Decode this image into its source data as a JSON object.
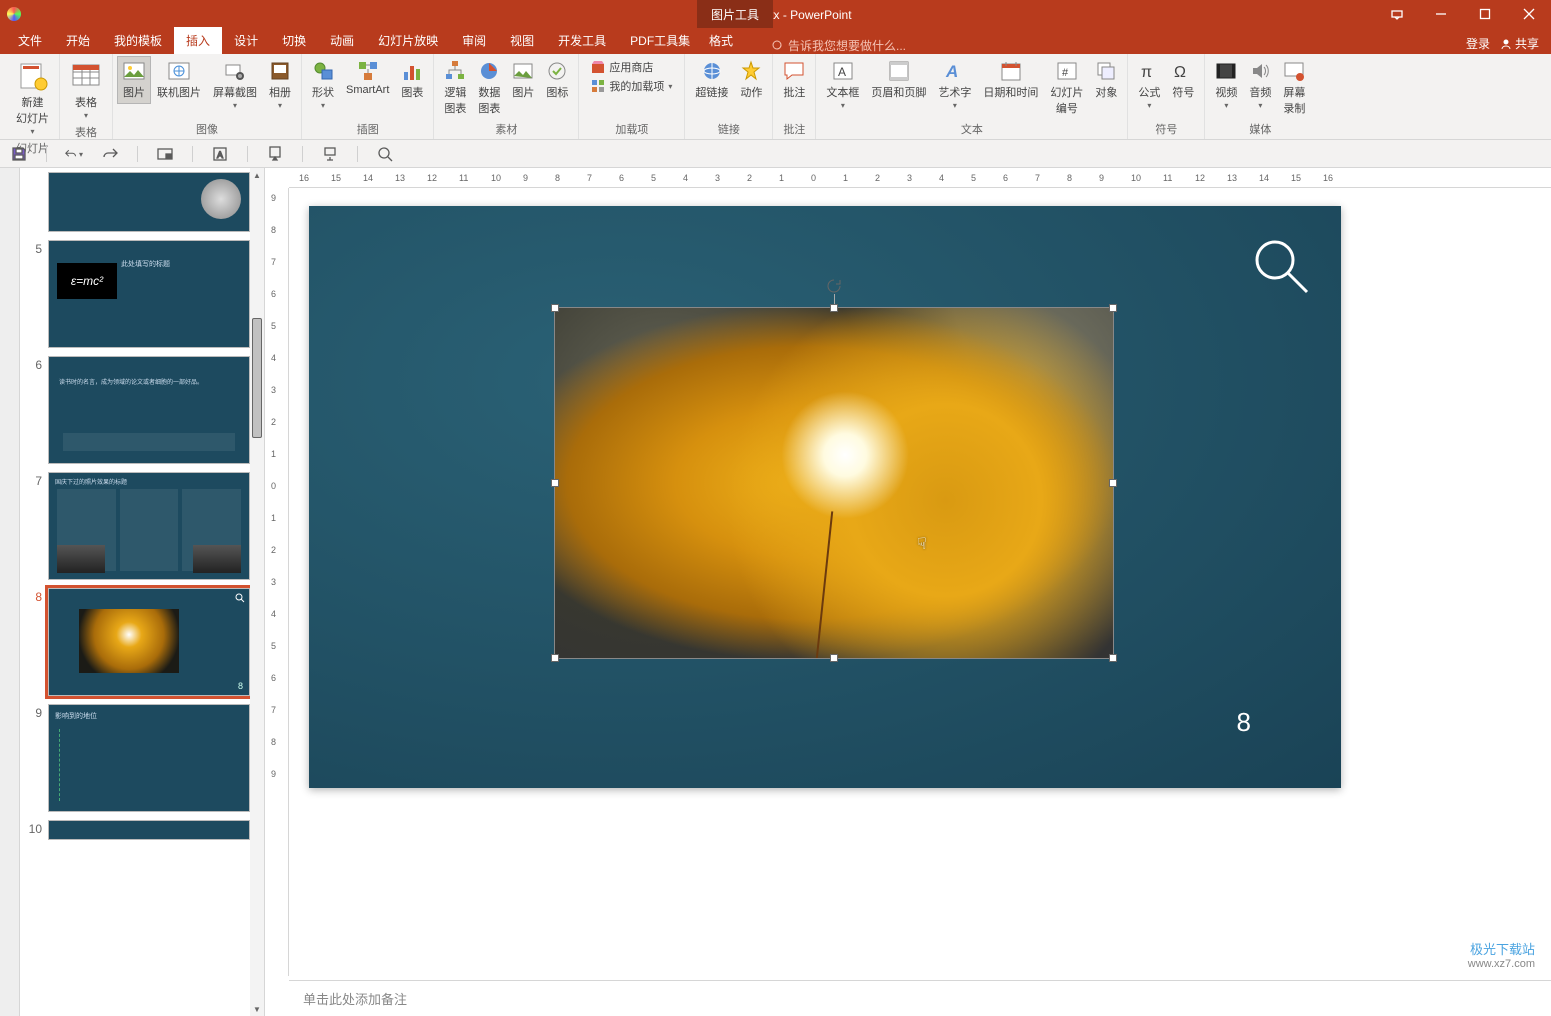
{
  "app": {
    "title": "PPT教程2.pptx - PowerPoint",
    "context_tool": "图片工具"
  },
  "window_controls": {
    "displaymode": "",
    "minimize": "",
    "maximize": "",
    "close": ""
  },
  "tabs": {
    "items": [
      "文件",
      "开始",
      "我的模板",
      "插入",
      "设计",
      "切换",
      "动画",
      "幻灯片放映",
      "审阅",
      "视图",
      "开发工具",
      "PDF工具集"
    ],
    "active_index": 3,
    "context_tab": "格式",
    "tellme_placeholder": "告诉我您想要做什么...",
    "login": "登录",
    "share": "共享"
  },
  "ribbon": {
    "groups": [
      {
        "label": "幻灯片",
        "buttons": [
          {
            "k": "new",
            "t": "新建\n幻灯片",
            "drop": true
          }
        ]
      },
      {
        "label": "表格",
        "buttons": [
          {
            "k": "table",
            "t": "表格",
            "drop": true
          }
        ]
      },
      {
        "label": "图像",
        "buttons": [
          {
            "k": "pic",
            "t": "图片",
            "pressed": true
          },
          {
            "k": "online",
            "t": "联机图片"
          },
          {
            "k": "screenshot",
            "t": "屏幕截图",
            "drop": true
          },
          {
            "k": "album",
            "t": "相册",
            "drop": true
          }
        ]
      },
      {
        "label": "插图",
        "buttons": [
          {
            "k": "shapes",
            "t": "形状",
            "drop": true
          },
          {
            "k": "smartart",
            "t": "SmartArt"
          },
          {
            "k": "chart",
            "t": "图表"
          }
        ]
      },
      {
        "label": "素材",
        "buttons": [
          {
            "k": "logic",
            "t": "逻辑\n图表"
          },
          {
            "k": "data",
            "t": "数据\n图表"
          },
          {
            "k": "picmat",
            "t": "图片"
          },
          {
            "k": "iconmat",
            "t": "图标"
          }
        ]
      },
      {
        "label": "加载项",
        "small": true,
        "rows": [
          {
            "k": "store",
            "t": "应用商店"
          },
          {
            "k": "addins",
            "t": "我的加载项",
            "drop": true
          }
        ]
      },
      {
        "label": "链接",
        "buttons": [
          {
            "k": "hyperlink",
            "t": "超链接"
          },
          {
            "k": "action",
            "t": "动作"
          }
        ]
      },
      {
        "label": "批注",
        "buttons": [
          {
            "k": "comment",
            "t": "批注"
          }
        ]
      },
      {
        "label": "文本",
        "buttons": [
          {
            "k": "textbox",
            "t": "文本框",
            "drop": true
          },
          {
            "k": "headerfooter",
            "t": "页眉和页脚"
          },
          {
            "k": "wordart",
            "t": "艺术字",
            "drop": true
          },
          {
            "k": "datetime",
            "t": "日期和时间"
          },
          {
            "k": "slidenum",
            "t": "幻灯片\n编号"
          },
          {
            "k": "object",
            "t": "对象"
          }
        ]
      },
      {
        "label": "符号",
        "buttons": [
          {
            "k": "equation",
            "t": "公式",
            "drop": true
          },
          {
            "k": "symbol",
            "t": "符号"
          }
        ]
      },
      {
        "label": "媒体",
        "buttons": [
          {
            "k": "video",
            "t": "视频",
            "drop": true
          },
          {
            "k": "audio",
            "t": "音频",
            "drop": true
          },
          {
            "k": "screenrec",
            "t": "屏幕\n录制"
          }
        ]
      }
    ]
  },
  "qat": {
    "save": "",
    "undo": "",
    "redo": "",
    "b1": "",
    "b2": "",
    "b3": "",
    "b4": "",
    "b5": ""
  },
  "ruler": {
    "h": [
      "16",
      "15",
      "14",
      "13",
      "12",
      "11",
      "10",
      "9",
      "8",
      "7",
      "6",
      "5",
      "4",
      "3",
      "2",
      "1",
      "0",
      "1",
      "2",
      "3",
      "4",
      "5",
      "6",
      "7",
      "8",
      "9",
      "10",
      "11",
      "12",
      "13",
      "14",
      "15",
      "16"
    ],
    "v": [
      "9",
      "8",
      "7",
      "6",
      "5",
      "4",
      "3",
      "2",
      "1",
      "0",
      "1",
      "2",
      "3",
      "4",
      "5",
      "6",
      "7",
      "8",
      "9"
    ]
  },
  "thumbs": [
    {
      "n": "",
      "type": "einstein",
      "partial": true
    },
    {
      "n": "5",
      "type": "emc",
      "title": "此处填写的标题"
    },
    {
      "n": "6",
      "type": "quote"
    },
    {
      "n": "7",
      "type": "cols",
      "title": "国庆下过的照片效果的标题"
    },
    {
      "n": "8",
      "type": "leaf",
      "sel": true
    },
    {
      "n": "9",
      "type": "list",
      "title": "影响到的地位"
    },
    {
      "n": "10",
      "type": "blank",
      "partial": true
    }
  ],
  "slide": {
    "page": "8"
  },
  "notes": {
    "placeholder": "单击此处添加备注"
  },
  "watermark": {
    "line1": "极光下载站",
    "line2": "www.xz7.com"
  },
  "emc": "ε=mc²"
}
